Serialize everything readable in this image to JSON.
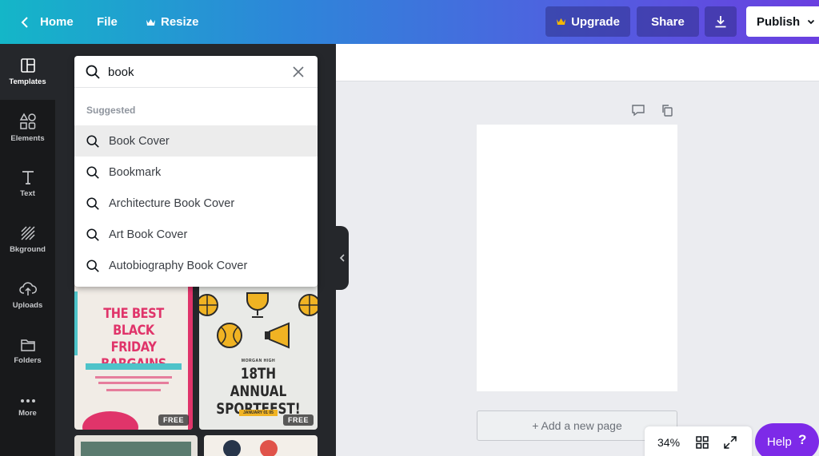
{
  "topbar": {
    "home_label": "Home",
    "file_label": "File",
    "resize_label": "Resize",
    "upgrade_label": "Upgrade",
    "share_label": "Share",
    "publish_label": "Publish",
    "gradient_start": "#14b6c8",
    "gradient_end": "#6a3fe0"
  },
  "rail": {
    "items": [
      {
        "label": "Templates",
        "icon": "templates-icon"
      },
      {
        "label": "Elements",
        "icon": "elements-icon"
      },
      {
        "label": "Text",
        "icon": "text-icon"
      },
      {
        "label": "Bkground",
        "icon": "background-icon"
      },
      {
        "label": "Uploads",
        "icon": "uploads-icon"
      },
      {
        "label": "Folders",
        "icon": "folder-icon"
      },
      {
        "label": "More",
        "icon": "more-icon"
      }
    ]
  },
  "search": {
    "value": "book",
    "suggested_label": "Suggested",
    "suggestions": [
      "Book Cover",
      "Bookmark",
      "Architecture Book Cover",
      "Art Book Cover",
      "Autobiography Book Cover"
    ]
  },
  "templates": {
    "free_badge": "FREE",
    "bf_lines": [
      "THE BEST",
      "BLACK FRIDAY",
      "BARGAINS"
    ],
    "sf_subtitle": "MORGAN HIGH",
    "sf_lines": [
      "18TH ANNUAL",
      "SPORTFEST!"
    ],
    "sf_date": "JANUARY 01 05"
  },
  "canvas": {
    "add_page_label": "+ Add a new page",
    "zoom": "34%"
  },
  "help": {
    "label": "Help",
    "question": "?"
  },
  "colors": {
    "accent": "#7d2ae8",
    "rail_bg": "#18191b",
    "panel_bg": "#25272b"
  }
}
